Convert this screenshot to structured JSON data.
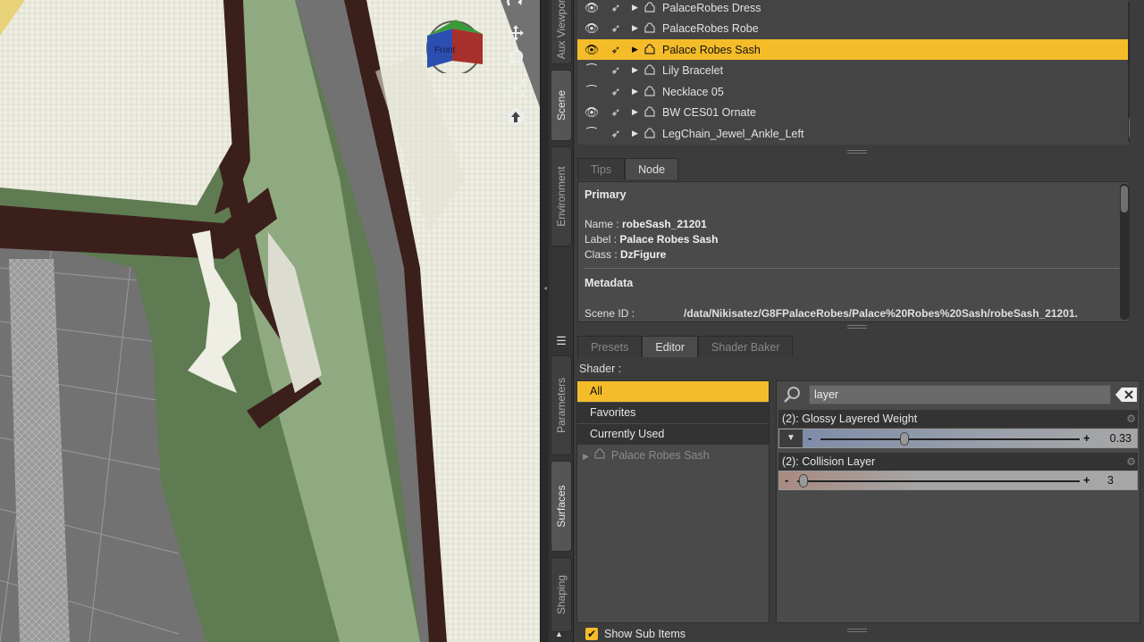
{
  "viewport": {
    "viewcube_label": "Front",
    "tools": [
      "rotate-icon",
      "pan-icon",
      "zoom-icon",
      "frame-icon",
      "orbit-up-icon"
    ]
  },
  "vertical_tabs": [
    "Aux Viewport",
    "Scene",
    "Environment",
    "Parameters",
    "Surfaces",
    "Shaping"
  ],
  "scene": {
    "items": [
      {
        "label": "PalaceRobes Dress",
        "visible": true,
        "selected": false
      },
      {
        "label": "PalaceRobes Robe",
        "visible": true,
        "selected": false
      },
      {
        "label": "Palace Robes Sash",
        "visible": true,
        "selected": true
      },
      {
        "label": "Lily Bracelet",
        "visible": false,
        "selected": false
      },
      {
        "label": "Necklace 05",
        "visible": false,
        "selected": false
      },
      {
        "label": "BW CES01 Ornate",
        "visible": true,
        "selected": false
      },
      {
        "label": "LegChain_Jewel_Ankle_Left",
        "visible": false,
        "selected": false
      }
    ]
  },
  "info_tabs": [
    "Tips",
    "Node"
  ],
  "node": {
    "primary_title": "Primary",
    "name_key": "Name : ",
    "name_val": "robeSash_21201",
    "label_key": "Label : ",
    "label_val": "Palace Robes Sash",
    "class_key": "Class : ",
    "class_val": "DzFigure",
    "metadata_title": "Metadata",
    "scene_id_key": "Scene ID :",
    "scene_id_val": "/data/Nikisatez/G8FPalaceRobes/Palace%20Robes%20Sash/robeSash_21201."
  },
  "surface_tabs": [
    "Presets",
    "Editor",
    "Shader Baker"
  ],
  "surfaces": {
    "shader_label": "Shader :",
    "list": [
      "All",
      "Favorites",
      "Currently Used",
      "Palace Robes Sash"
    ],
    "show_sub_items": "Show Sub Items",
    "search_value": "layer",
    "params": [
      {
        "label": "(2): Glossy Layered Weight",
        "value": "0.33",
        "fraction": 0.33
      },
      {
        "label": "(2): Collision Layer",
        "value": "3",
        "fraction": 0.0
      }
    ]
  },
  "colors": {
    "accent": "#f5bc2a"
  }
}
